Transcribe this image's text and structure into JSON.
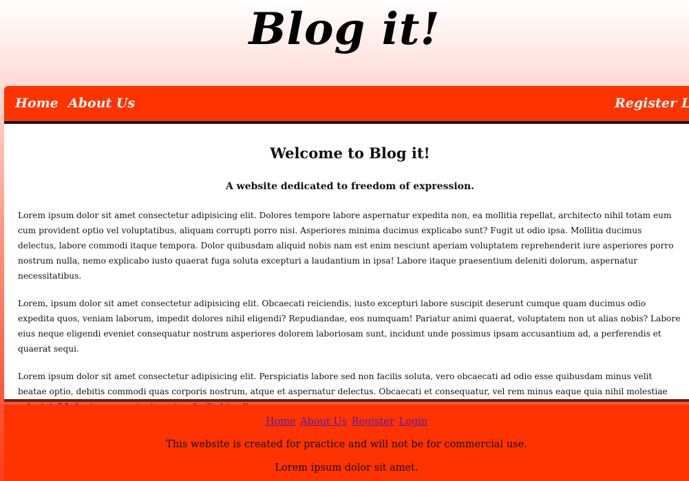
{
  "brand": {
    "logo_text": "Blog it!"
  },
  "nav": {
    "home": "Home",
    "about": "About Us",
    "register": "Register",
    "login": "Login"
  },
  "main": {
    "title": "Welcome to Blog it!",
    "tagline": "A website dedicated to freedom of expression.",
    "paragraphs": [
      "Lorem ipsum dolor sit amet consectetur adipisicing elit. Dolores tempore labore aspernatur expedita non, ea mollitia repellat, architecto nihil totam eum cum provident optio vel voluptatibus, aliquam corrupti porro nisi. Asperiores minima ducimus explicabo sunt? Fugit ut odio ipsa. Mollitia ducimus delectus, labore commodi itaque tempora. Dolor quibusdam aliquid nobis nam est enim nesciunt aperiam voluptatem reprehenderit iure asperiores porro nostrum nulla, nemo explicabo iusto quaerat fuga soluta excepturi a laudantium in ipsa! Labore itaque praesentium deleniti dolorum, aspernatur necessitatibus.",
      "Lorem, ipsum dolor sit amet consectetur adipisicing elit. Obcaecati reiciendis, iusto excepturi labore suscipit deserunt cumque quam ducimus odio expedita quos, veniam laborum, impedit dolores nihil eligendi? Repudiandae, eos numquam! Pariatur animi quaerat, voluptatem non ut alias nobis? Labore eius neque eligendi eveniet consequatur nostrum asperiores dolorem laboriosam sunt, incidunt unde possimus ipsam accusantium ad, a perferendis et quaerat sequi.",
      "Lorem ipsum dolor sit amet consectetur adipisicing elit. Perspiciatis labore sed non facilis soluta, vero obcaecati ad odio esse quibusdam minus velit beatae optio, debitis commodi quas corporis nostrum, atque et aspernatur delectus. Obcaecati et consequatur, vel rem minus eaque quia nihil molestiae voluptate? Laboriosam nesciunt maxime facilis hic odio."
    ]
  },
  "footer": {
    "links": [
      "Home",
      "About Us",
      "Register",
      "Login"
    ],
    "notice": "This website is created for practice and will not be for commercial use.",
    "extra": "Lorem ipsum dolor sit amet."
  },
  "colors": {
    "nav_background": "#ff3300",
    "nav_text": "#ffffff",
    "footer_link": "#5a1aa8"
  }
}
